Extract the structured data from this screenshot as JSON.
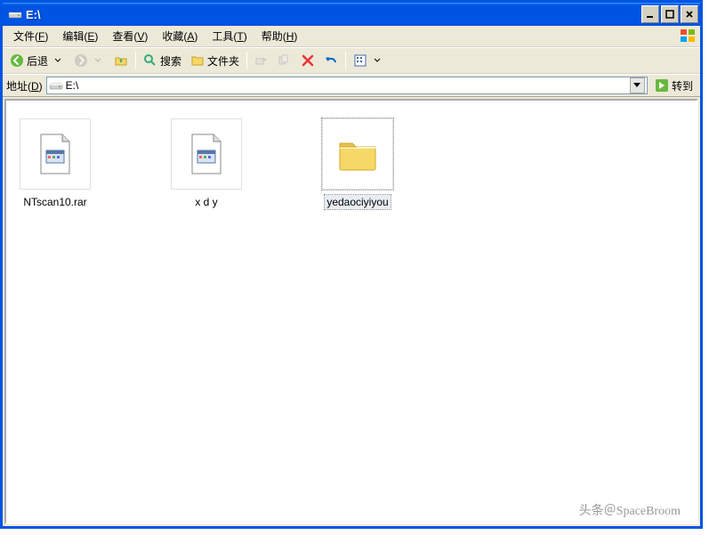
{
  "window": {
    "title": "E:\\"
  },
  "menu": {
    "file": "文件(",
    "file_u": "F",
    "file_end": ")",
    "edit": "编辑(",
    "edit_u": "E",
    "edit_end": ")",
    "view": "查看(",
    "view_u": "V",
    "view_end": ")",
    "fav": "收藏(",
    "fav_u": "A",
    "fav_end": ")",
    "tools": "工具(",
    "tools_u": "T",
    "tools_end": ")",
    "help": "帮助(",
    "help_u": "H",
    "help_end": ")"
  },
  "toolbar": {
    "back": "后退",
    "search": "搜索",
    "folders": "文件夹"
  },
  "addressbar": {
    "label": "地址(",
    "label_u": "D",
    "label_end": ")",
    "path": "E:\\",
    "go": "转到"
  },
  "items": [
    {
      "name": "NTscan10.rar",
      "type": "archive"
    },
    {
      "name": "x d y",
      "type": "archive"
    },
    {
      "name": "yedaociyiyou",
      "type": "folder",
      "selected": true
    }
  ],
  "watermark": "头条＠SpaceBroom"
}
